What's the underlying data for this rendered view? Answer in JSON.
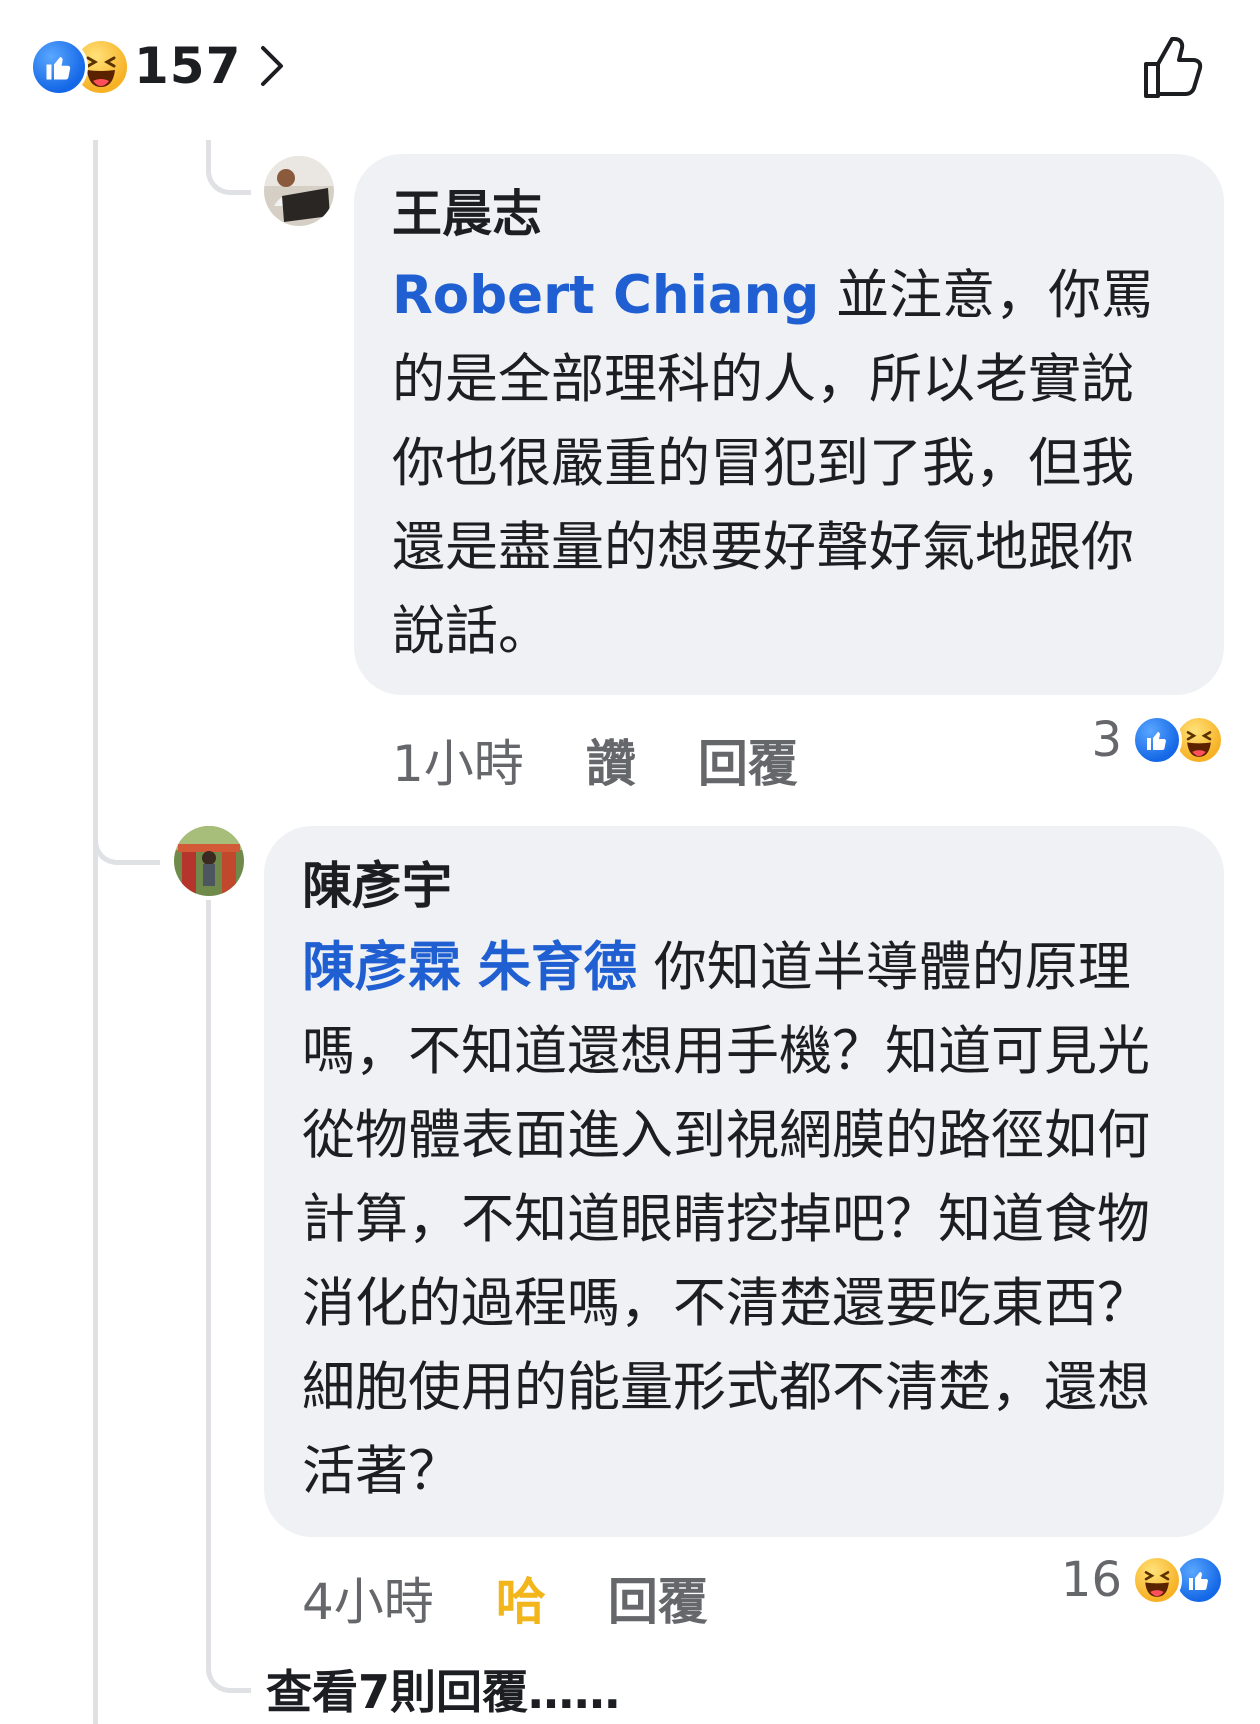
{
  "header": {
    "reaction_count": "157",
    "reaction_icons": [
      "like-icon",
      "haha-icon"
    ],
    "like_button_icon": "thumbs-up-outline-icon"
  },
  "comments": [
    {
      "author": "王晨志",
      "mentions": [
        "Robert Chiang"
      ],
      "text": " 並注意，你罵的是全部理科的人，所以老實說你也很嚴重的冒犯到了我，但我還是盡量的想要好聲好氣地跟你說話。",
      "time": "1小時",
      "action_like": "讚",
      "action_reply": "回覆",
      "reaction_count": "3",
      "reaction_icons": [
        "like-icon",
        "haha-icon"
      ]
    },
    {
      "author": "陳彥宇",
      "mentions": [
        "陳彥霖",
        "朱育德"
      ],
      "text": " 你知道半導體的原理嗎，不知道還想用手機？知道可見光從物體表面進入到視網膜的路徑如何計算，不知道眼睛挖掉吧？知道食物消化的過程嗎，不清楚還要吃東西？細胞使用的能量形式都不清楚，還想活著？",
      "time": "4小時",
      "action_like": "哈",
      "action_reply": "回覆",
      "reaction_count": "16",
      "reaction_icons": [
        "haha-icon",
        "like-icon"
      ]
    }
  ],
  "view_more_replies": "查看7則回覆……",
  "colors": {
    "link": "#1f5fd1",
    "bubble": "#eff1f4",
    "meta": "#65676b",
    "haha_active": "#f2b51a",
    "like_blue": "#1467e6"
  }
}
